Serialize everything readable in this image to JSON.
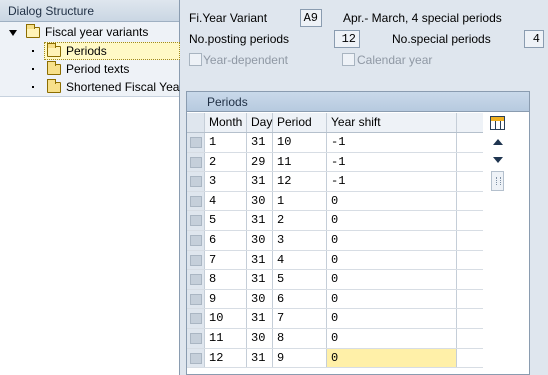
{
  "dialog_structure": {
    "title": "Dialog Structure",
    "root": "Fiscal year variants",
    "children": [
      "Periods",
      "Period texts",
      "Shortened Fiscal Yea"
    ]
  },
  "header": {
    "fy_variant_label": "Fi.Year Variant",
    "fy_variant_value": "A9",
    "fy_variant_desc": "Apr.- March, 4 special periods",
    "posting_periods_label": "No.posting periods",
    "posting_periods_value": "12",
    "special_periods_label": "No.special periods",
    "special_periods_value": "4",
    "year_dependent_label": "Year-dependent",
    "calendar_year_label": "Calendar year"
  },
  "table": {
    "title": "Periods",
    "columns": [
      "Month",
      "Day",
      "Period",
      "Year shift"
    ],
    "rows": [
      [
        "1",
        "31",
        "10",
        "-1"
      ],
      [
        "2",
        "29",
        "11",
        "-1"
      ],
      [
        "3",
        "31",
        "12",
        "-1"
      ],
      [
        "4",
        "30",
        "1",
        "0"
      ],
      [
        "5",
        "31",
        "2",
        "0"
      ],
      [
        "6",
        "30",
        "3",
        "0"
      ],
      [
        "7",
        "31",
        "4",
        "0"
      ],
      [
        "8",
        "31",
        "5",
        "0"
      ],
      [
        "9",
        "30",
        "6",
        "0"
      ],
      [
        "10",
        "31",
        "7",
        "0"
      ],
      [
        "11",
        "30",
        "8",
        "0"
      ],
      [
        "12",
        "31",
        "9",
        "0"
      ]
    ]
  }
}
